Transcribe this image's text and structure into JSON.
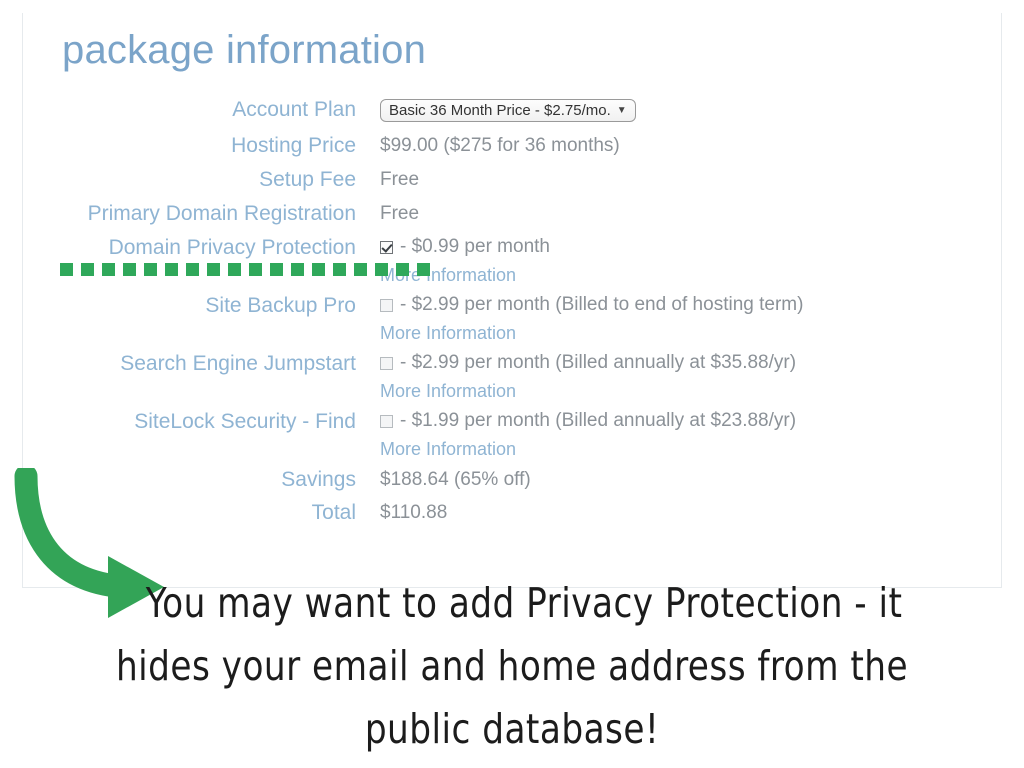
{
  "card": {
    "title": "package information"
  },
  "form": {
    "rows": [
      {
        "label": "Account Plan",
        "type": "select",
        "value": "Basic 36 Month Price - $2.75/mo.",
        "caret": "▼",
        "name": "account-plan"
      },
      {
        "label": "Hosting Price",
        "type": "text",
        "value": "$99.00  ($275 for 36 months)",
        "name": "hosting-price"
      },
      {
        "label": "Setup Fee",
        "type": "text",
        "value": "Free",
        "name": "setup-fee"
      },
      {
        "label": "Primary Domain Registration",
        "type": "text",
        "value": "Free",
        "name": "primary-domain-registration"
      },
      {
        "label": "Domain Privacy Protection",
        "type": "checkbox",
        "checked": true,
        "value": "- $0.99 per month",
        "more_info": "More Information",
        "name": "domain-privacy-protection"
      },
      {
        "label": "Site Backup Pro",
        "type": "checkbox",
        "checked": false,
        "value": "- $2.99 per month (Billed to end of hosting term)",
        "more_info": "More Information",
        "name": "site-backup-pro"
      },
      {
        "label": "Search Engine Jumpstart",
        "type": "checkbox",
        "checked": false,
        "value": "- $2.99 per month (Billed annually at $35.88/yr)",
        "more_info": "More Information",
        "name": "search-engine-jumpstart"
      },
      {
        "label": "SiteLock Security - Find",
        "type": "checkbox",
        "checked": false,
        "value": "- $1.99 per month (Billed annually at $23.88/yr)",
        "more_info": "More Information",
        "name": "sitelock-security-find"
      },
      {
        "label": "Savings",
        "type": "text",
        "value": "$188.64 (65% off)",
        "name": "savings"
      },
      {
        "label": "Total",
        "type": "text",
        "value": "$110.88",
        "name": "total"
      }
    ]
  },
  "annotation": {
    "line1": "You may want to add Privacy Protection - it",
    "line2": "hides your email and home address from the",
    "line3": "public database!"
  },
  "colors": {
    "label_blue": "#8fb4d3",
    "title_blue": "#7ba4c9",
    "value_gray": "#8b9197",
    "accent_green": "#2fa85a",
    "card_border": "#e6eaed"
  }
}
